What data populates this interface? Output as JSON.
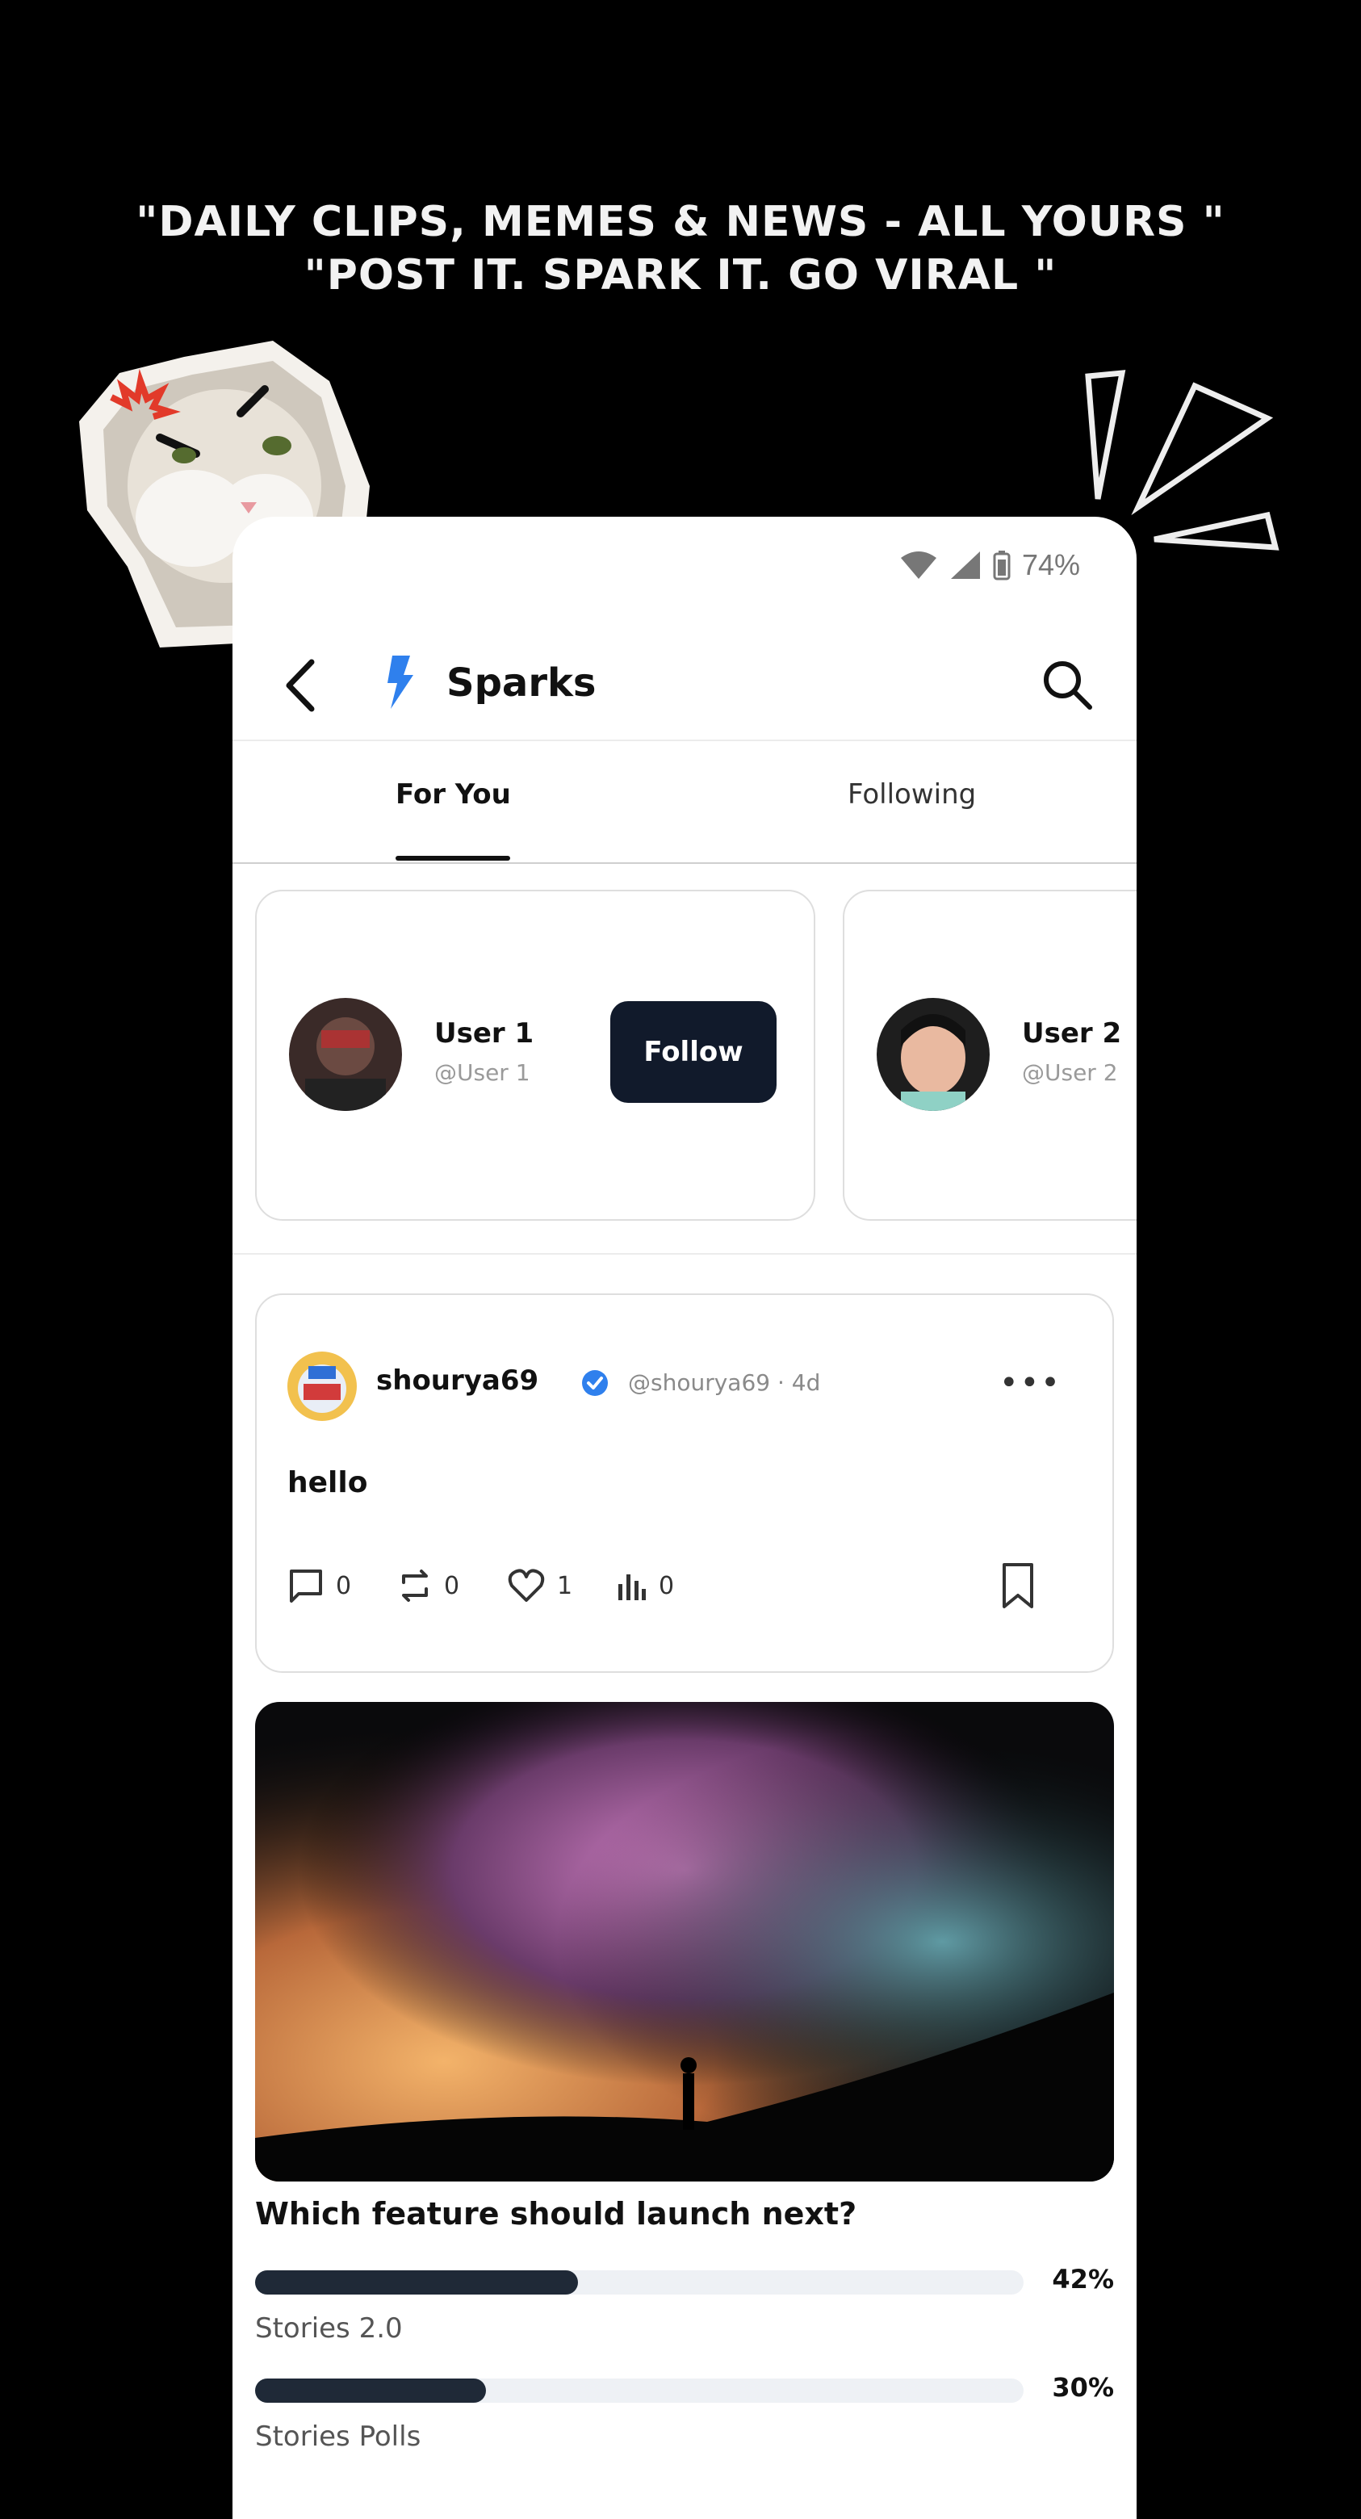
{
  "promo": {
    "line1": "\"DAILY CLIPS, MEMES & NEWS - ALL YOURS \"",
    "line2": "\"POST IT. SPARK IT. GO VIRAL \""
  },
  "status_bar": {
    "battery": "74%"
  },
  "header": {
    "title": "Sparks"
  },
  "tabs": [
    {
      "label": "For You"
    },
    {
      "label": "Following"
    }
  ],
  "suggested_users": [
    {
      "name": "User 1",
      "handle": "@User 1",
      "follow_label": "Follow"
    },
    {
      "name": "User 2",
      "handle": "@User 2"
    }
  ],
  "post": {
    "author": "shourya69",
    "meta": "@shourya69 · 4d",
    "text": "hello",
    "comments": "0",
    "reposts": "0",
    "likes": "1",
    "views": "0"
  },
  "poll": {
    "question": "Which feature should launch next?",
    "options": [
      {
        "label": "Stories 2.0",
        "percent": "42%",
        "fraction": 0.42
      },
      {
        "label": "Stories Polls",
        "percent": "30%",
        "fraction": 0.3
      }
    ]
  },
  "colors": {
    "background": "#000000",
    "accent_blue": "#2f80ed",
    "button_dark": "#111a2b",
    "poll_fill": "#1f2937"
  }
}
